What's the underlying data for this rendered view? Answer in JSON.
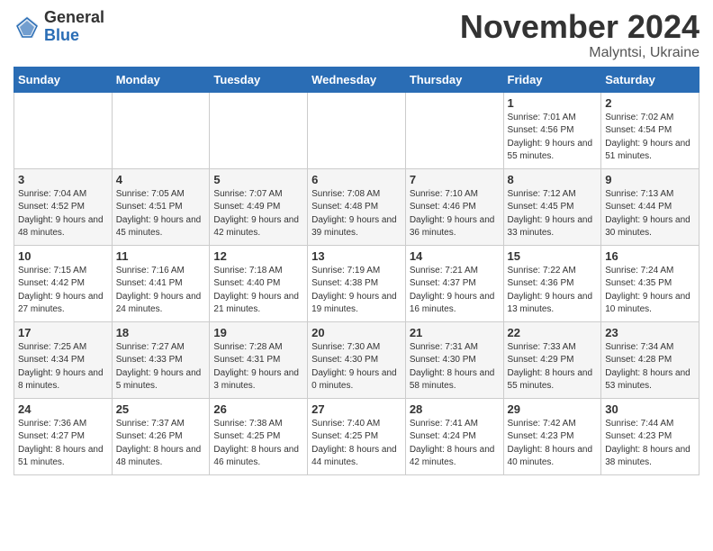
{
  "logo": {
    "general": "General",
    "blue": "Blue"
  },
  "header": {
    "month": "November 2024",
    "location": "Malyntsi, Ukraine"
  },
  "days_of_week": [
    "Sunday",
    "Monday",
    "Tuesday",
    "Wednesday",
    "Thursday",
    "Friday",
    "Saturday"
  ],
  "weeks": [
    [
      {
        "day": "",
        "info": ""
      },
      {
        "day": "",
        "info": ""
      },
      {
        "day": "",
        "info": ""
      },
      {
        "day": "",
        "info": ""
      },
      {
        "day": "",
        "info": ""
      },
      {
        "day": "1",
        "info": "Sunrise: 7:01 AM\nSunset: 4:56 PM\nDaylight: 9 hours and 55 minutes."
      },
      {
        "day": "2",
        "info": "Sunrise: 7:02 AM\nSunset: 4:54 PM\nDaylight: 9 hours and 51 minutes."
      }
    ],
    [
      {
        "day": "3",
        "info": "Sunrise: 7:04 AM\nSunset: 4:52 PM\nDaylight: 9 hours and 48 minutes."
      },
      {
        "day": "4",
        "info": "Sunrise: 7:05 AM\nSunset: 4:51 PM\nDaylight: 9 hours and 45 minutes."
      },
      {
        "day": "5",
        "info": "Sunrise: 7:07 AM\nSunset: 4:49 PM\nDaylight: 9 hours and 42 minutes."
      },
      {
        "day": "6",
        "info": "Sunrise: 7:08 AM\nSunset: 4:48 PM\nDaylight: 9 hours and 39 minutes."
      },
      {
        "day": "7",
        "info": "Sunrise: 7:10 AM\nSunset: 4:46 PM\nDaylight: 9 hours and 36 minutes."
      },
      {
        "day": "8",
        "info": "Sunrise: 7:12 AM\nSunset: 4:45 PM\nDaylight: 9 hours and 33 minutes."
      },
      {
        "day": "9",
        "info": "Sunrise: 7:13 AM\nSunset: 4:44 PM\nDaylight: 9 hours and 30 minutes."
      }
    ],
    [
      {
        "day": "10",
        "info": "Sunrise: 7:15 AM\nSunset: 4:42 PM\nDaylight: 9 hours and 27 minutes."
      },
      {
        "day": "11",
        "info": "Sunrise: 7:16 AM\nSunset: 4:41 PM\nDaylight: 9 hours and 24 minutes."
      },
      {
        "day": "12",
        "info": "Sunrise: 7:18 AM\nSunset: 4:40 PM\nDaylight: 9 hours and 21 minutes."
      },
      {
        "day": "13",
        "info": "Sunrise: 7:19 AM\nSunset: 4:38 PM\nDaylight: 9 hours and 19 minutes."
      },
      {
        "day": "14",
        "info": "Sunrise: 7:21 AM\nSunset: 4:37 PM\nDaylight: 9 hours and 16 minutes."
      },
      {
        "day": "15",
        "info": "Sunrise: 7:22 AM\nSunset: 4:36 PM\nDaylight: 9 hours and 13 minutes."
      },
      {
        "day": "16",
        "info": "Sunrise: 7:24 AM\nSunset: 4:35 PM\nDaylight: 9 hours and 10 minutes."
      }
    ],
    [
      {
        "day": "17",
        "info": "Sunrise: 7:25 AM\nSunset: 4:34 PM\nDaylight: 9 hours and 8 minutes."
      },
      {
        "day": "18",
        "info": "Sunrise: 7:27 AM\nSunset: 4:33 PM\nDaylight: 9 hours and 5 minutes."
      },
      {
        "day": "19",
        "info": "Sunrise: 7:28 AM\nSunset: 4:31 PM\nDaylight: 9 hours and 3 minutes."
      },
      {
        "day": "20",
        "info": "Sunrise: 7:30 AM\nSunset: 4:30 PM\nDaylight: 9 hours and 0 minutes."
      },
      {
        "day": "21",
        "info": "Sunrise: 7:31 AM\nSunset: 4:30 PM\nDaylight: 8 hours and 58 minutes."
      },
      {
        "day": "22",
        "info": "Sunrise: 7:33 AM\nSunset: 4:29 PM\nDaylight: 8 hours and 55 minutes."
      },
      {
        "day": "23",
        "info": "Sunrise: 7:34 AM\nSunset: 4:28 PM\nDaylight: 8 hours and 53 minutes."
      }
    ],
    [
      {
        "day": "24",
        "info": "Sunrise: 7:36 AM\nSunset: 4:27 PM\nDaylight: 8 hours and 51 minutes."
      },
      {
        "day": "25",
        "info": "Sunrise: 7:37 AM\nSunset: 4:26 PM\nDaylight: 8 hours and 48 minutes."
      },
      {
        "day": "26",
        "info": "Sunrise: 7:38 AM\nSunset: 4:25 PM\nDaylight: 8 hours and 46 minutes."
      },
      {
        "day": "27",
        "info": "Sunrise: 7:40 AM\nSunset: 4:25 PM\nDaylight: 8 hours and 44 minutes."
      },
      {
        "day": "28",
        "info": "Sunrise: 7:41 AM\nSunset: 4:24 PM\nDaylight: 8 hours and 42 minutes."
      },
      {
        "day": "29",
        "info": "Sunrise: 7:42 AM\nSunset: 4:23 PM\nDaylight: 8 hours and 40 minutes."
      },
      {
        "day": "30",
        "info": "Sunrise: 7:44 AM\nSunset: 4:23 PM\nDaylight: 8 hours and 38 minutes."
      }
    ]
  ]
}
